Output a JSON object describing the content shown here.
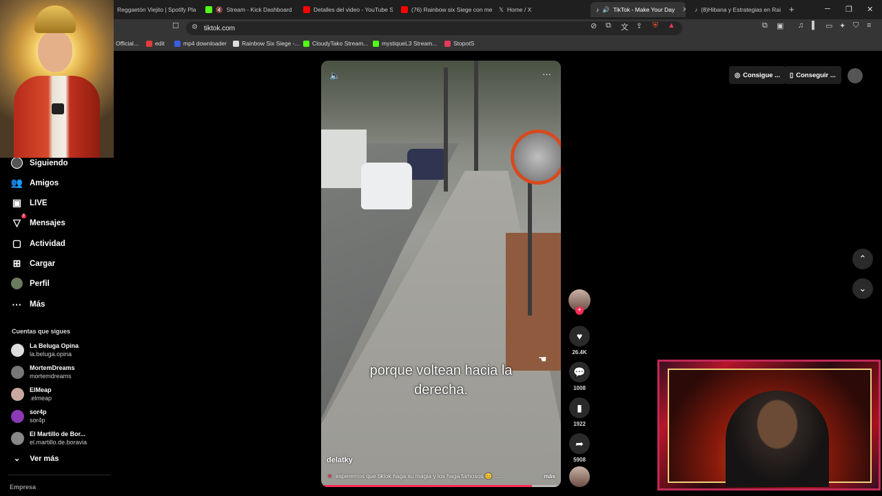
{
  "browser": {
    "tabs": [
      {
        "title": "Reggaetón Viejito | Spotify Pla",
        "color": "#1db954"
      },
      {
        "title": "Stream - Kick Dashboard",
        "color": "#53fc18"
      },
      {
        "title": "Detalles del video - YouTube S",
        "color": "#ff0000"
      },
      {
        "title": "(76) Rainbow six Siege con me",
        "color": "#ff0000"
      },
      {
        "title": "Home / X",
        "color": "#ffffff"
      },
      {
        "title": "TikTok - Make Your Day",
        "color": "#ffffff"
      },
      {
        "title": "(8)Hibana y Estrategias en Rai",
        "color": "#ffffff"
      }
    ],
    "url": "tiktok.com",
    "bookmarks": [
      {
        "label": "Official...",
        "color": "#777"
      },
      {
        "label": "edit",
        "color": "#e23b3b"
      },
      {
        "label": "mp4 downloader",
        "color": "#3b5de2"
      },
      {
        "label": "Rainbow Six Siege -...",
        "color": "#ddd"
      },
      {
        "label": "CloudyTako Stream...",
        "color": "#53fc18"
      },
      {
        "label": "mystiqueL3 Stream...",
        "color": "#53fc18"
      },
      {
        "label": "StopotS",
        "color": "#e23b5b"
      }
    ]
  },
  "sidebar": {
    "nav": [
      {
        "label": "Siguiendo",
        "icon": "following-icon"
      },
      {
        "label": "Amigos",
        "icon": "friends-icon"
      },
      {
        "label": "LIVE",
        "icon": "live-icon"
      },
      {
        "label": "Mensajes",
        "icon": "messages-icon",
        "badge": "7"
      },
      {
        "label": "Actividad",
        "icon": "activity-icon"
      },
      {
        "label": "Cargar",
        "icon": "upload-icon"
      },
      {
        "label": "Perfil",
        "icon": "profile-icon"
      },
      {
        "label": "Más",
        "icon": "more-icon"
      }
    ],
    "following_title": "Cuentas que sigues",
    "following": [
      {
        "name": "La Beluga Opina",
        "handle": "la.beluga.opina"
      },
      {
        "name": "MortemDreams",
        "handle": "mortemdreams"
      },
      {
        "name": "ElMeap",
        "handle": ".elmeap"
      },
      {
        "name": "sor4p",
        "handle": "sor4p"
      },
      {
        "name": "El Martillo de Bor...",
        "handle": "el.martillo.de.boravia"
      }
    ],
    "see_more": "Ver más",
    "footer": "Empresa"
  },
  "video": {
    "subtitle_line1": "porque voltean hacia la",
    "subtitle_line2": "derecha.",
    "author": "delatky",
    "description": "esperemos que tiktok haga su magia y los haga famosos 😊",
    "ellipsis": "...",
    "more": "más",
    "progress": 0.88
  },
  "actions": {
    "likes": "26.4K",
    "comments": "1008",
    "saves": "1922",
    "shares": "5908"
  },
  "header": {
    "get_coins": "Consigue ...",
    "get_app": "Conseguir ..."
  }
}
